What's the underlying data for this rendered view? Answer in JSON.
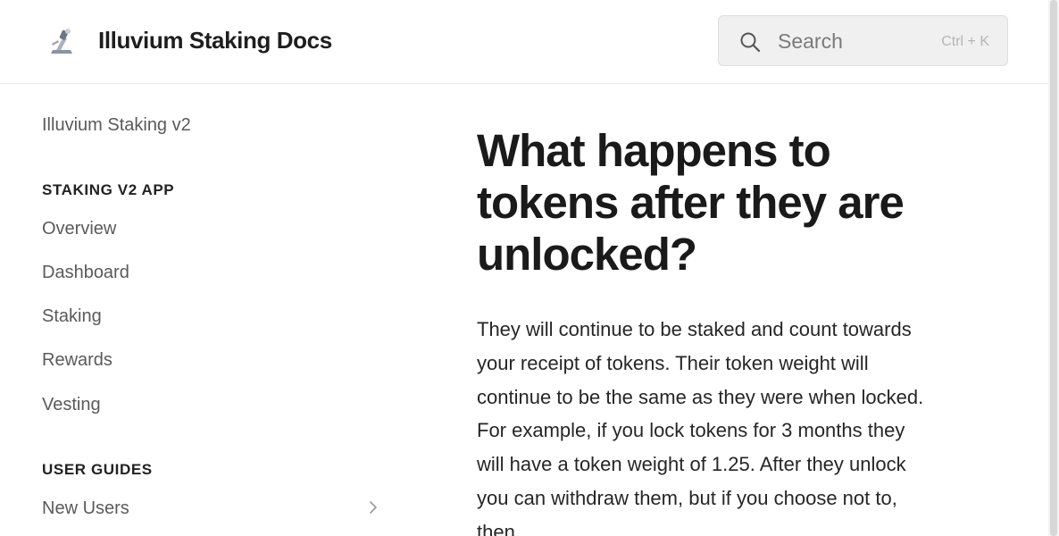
{
  "header": {
    "logo_icon": "illuvium-logo-icon",
    "title": "Illuvium Staking Docs",
    "search": {
      "placeholder": "Search",
      "shortcut": "Ctrl + K",
      "icon": "search-icon"
    }
  },
  "sidebar": {
    "top_link": "Illuvium Staking v2",
    "sections": [
      {
        "heading": "STAKING V2 APP",
        "items": [
          "Overview",
          "Dashboard",
          "Staking",
          "Rewards",
          "Vesting"
        ]
      },
      {
        "heading": "USER GUIDES",
        "items": [
          "New Users"
        ]
      }
    ],
    "expand_icon": "chevron-right-icon"
  },
  "main": {
    "title": "What happens to tokens after they are unlocked?",
    "paragraph": "They will continue to be staked and count towards your receipt of tokens. Their token weight will continue to be the same as they were when locked. For example, if you lock tokens for 3 months they will have a token weight of 1.25. After they unlock you can withdraw them, but if you choose not to, then"
  }
}
